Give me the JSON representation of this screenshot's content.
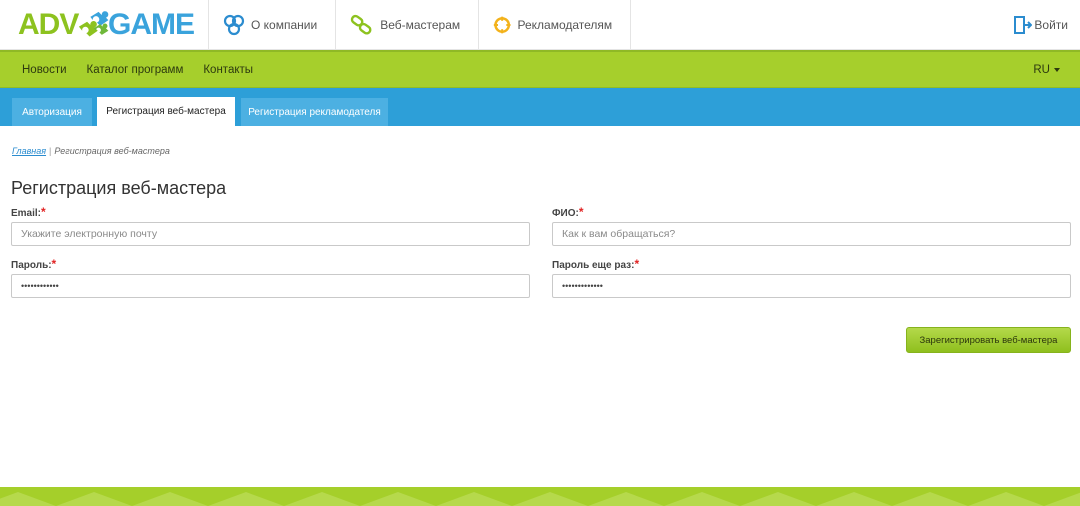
{
  "logo": {
    "part1": "ADV",
    "part2": "GAME"
  },
  "topnav": {
    "items": [
      {
        "label": "О компании",
        "icon": "company-icon"
      },
      {
        "label": "Веб-мастерам",
        "icon": "chain-link-icon"
      },
      {
        "label": "Рекламодателям",
        "icon": "target-icon"
      }
    ],
    "login_label": "Войти"
  },
  "green_menu": {
    "links": [
      "Новости",
      "Каталог программ",
      "Контакты"
    ],
    "language": "RU"
  },
  "tabs": [
    {
      "label": "Авторизация",
      "active": false
    },
    {
      "label": "Регистрация веб-мастера",
      "active": true
    },
    {
      "label": "Регистрация рекламодателя",
      "active": false
    }
  ],
  "breadcrumb": {
    "home": "Главная",
    "separator": "|",
    "current": "Регистрация веб-мастера"
  },
  "page_title": "Регистрация веб-мастера",
  "form": {
    "email": {
      "label": "Email:",
      "required_mark": "*",
      "placeholder": "Укажите электронную почту",
      "value": ""
    },
    "fio": {
      "label": "ФИО:",
      "required_mark": "*",
      "placeholder": "Как к вам обращаться?",
      "value": ""
    },
    "password": {
      "label": "Пароль:",
      "required_mark": "*",
      "value": "••••••••••••"
    },
    "password_repeat": {
      "label": "Пароль еще раз:",
      "required_mark": "*",
      "value": "•••••••••••••"
    },
    "submit_label": "Зарегистрировать веб-мастера"
  },
  "colors": {
    "brand_green": "#a6cf2c",
    "brand_blue": "#2d9fd8",
    "required": "#e12424"
  }
}
